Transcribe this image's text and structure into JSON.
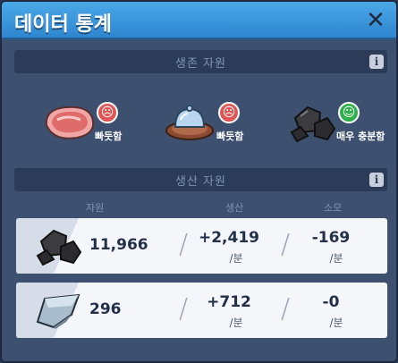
{
  "window": {
    "title": "데이터 통계"
  },
  "survival": {
    "header": "생존 자원",
    "items": [
      {
        "name": "meat",
        "status": "빠듯함",
        "mood": "sad"
      },
      {
        "name": "meal",
        "status": "빠듯함",
        "mood": "sad"
      },
      {
        "name": "coal",
        "status": "매우 충분함",
        "mood": "happy"
      }
    ]
  },
  "production": {
    "header": "생산 자원",
    "columns": {
      "resource": "자원",
      "produce": "생산",
      "consume": "소모"
    },
    "rows": [
      {
        "resource": "coal",
        "amount": "11,966",
        "produce": "+2,419",
        "produce_unit": "/분",
        "consume": "-169",
        "consume_unit": "/분"
      },
      {
        "resource": "iron",
        "amount": "296",
        "produce": "+712",
        "produce_unit": "/분",
        "consume": "-0",
        "consume_unit": "/분"
      }
    ]
  },
  "icons": {
    "close": "close-icon",
    "info": "info-icon",
    "sad": "sad-face-icon",
    "happy": "happy-face-icon"
  }
}
